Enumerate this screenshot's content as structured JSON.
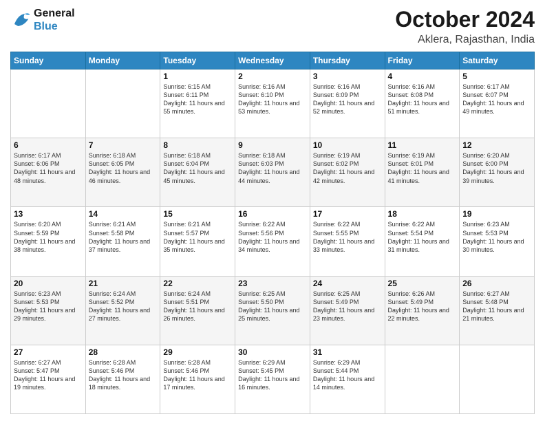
{
  "logo": {
    "line1": "General",
    "line2": "Blue"
  },
  "title": "October 2024",
  "subtitle": "Aklera, Rajasthan, India",
  "days_of_week": [
    "Sunday",
    "Monday",
    "Tuesday",
    "Wednesday",
    "Thursday",
    "Friday",
    "Saturday"
  ],
  "weeks": [
    [
      {
        "day": "",
        "sunrise": "",
        "sunset": "",
        "daylight": ""
      },
      {
        "day": "",
        "sunrise": "",
        "sunset": "",
        "daylight": ""
      },
      {
        "day": "1",
        "sunrise": "Sunrise: 6:15 AM",
        "sunset": "Sunset: 6:11 PM",
        "daylight": "Daylight: 11 hours and 55 minutes."
      },
      {
        "day": "2",
        "sunrise": "Sunrise: 6:16 AM",
        "sunset": "Sunset: 6:10 PM",
        "daylight": "Daylight: 11 hours and 53 minutes."
      },
      {
        "day": "3",
        "sunrise": "Sunrise: 6:16 AM",
        "sunset": "Sunset: 6:09 PM",
        "daylight": "Daylight: 11 hours and 52 minutes."
      },
      {
        "day": "4",
        "sunrise": "Sunrise: 6:16 AM",
        "sunset": "Sunset: 6:08 PM",
        "daylight": "Daylight: 11 hours and 51 minutes."
      },
      {
        "day": "5",
        "sunrise": "Sunrise: 6:17 AM",
        "sunset": "Sunset: 6:07 PM",
        "daylight": "Daylight: 11 hours and 49 minutes."
      }
    ],
    [
      {
        "day": "6",
        "sunrise": "Sunrise: 6:17 AM",
        "sunset": "Sunset: 6:06 PM",
        "daylight": "Daylight: 11 hours and 48 minutes."
      },
      {
        "day": "7",
        "sunrise": "Sunrise: 6:18 AM",
        "sunset": "Sunset: 6:05 PM",
        "daylight": "Daylight: 11 hours and 46 minutes."
      },
      {
        "day": "8",
        "sunrise": "Sunrise: 6:18 AM",
        "sunset": "Sunset: 6:04 PM",
        "daylight": "Daylight: 11 hours and 45 minutes."
      },
      {
        "day": "9",
        "sunrise": "Sunrise: 6:18 AM",
        "sunset": "Sunset: 6:03 PM",
        "daylight": "Daylight: 11 hours and 44 minutes."
      },
      {
        "day": "10",
        "sunrise": "Sunrise: 6:19 AM",
        "sunset": "Sunset: 6:02 PM",
        "daylight": "Daylight: 11 hours and 42 minutes."
      },
      {
        "day": "11",
        "sunrise": "Sunrise: 6:19 AM",
        "sunset": "Sunset: 6:01 PM",
        "daylight": "Daylight: 11 hours and 41 minutes."
      },
      {
        "day": "12",
        "sunrise": "Sunrise: 6:20 AM",
        "sunset": "Sunset: 6:00 PM",
        "daylight": "Daylight: 11 hours and 39 minutes."
      }
    ],
    [
      {
        "day": "13",
        "sunrise": "Sunrise: 6:20 AM",
        "sunset": "Sunset: 5:59 PM",
        "daylight": "Daylight: 11 hours and 38 minutes."
      },
      {
        "day": "14",
        "sunrise": "Sunrise: 6:21 AM",
        "sunset": "Sunset: 5:58 PM",
        "daylight": "Daylight: 11 hours and 37 minutes."
      },
      {
        "day": "15",
        "sunrise": "Sunrise: 6:21 AM",
        "sunset": "Sunset: 5:57 PM",
        "daylight": "Daylight: 11 hours and 35 minutes."
      },
      {
        "day": "16",
        "sunrise": "Sunrise: 6:22 AM",
        "sunset": "Sunset: 5:56 PM",
        "daylight": "Daylight: 11 hours and 34 minutes."
      },
      {
        "day": "17",
        "sunrise": "Sunrise: 6:22 AM",
        "sunset": "Sunset: 5:55 PM",
        "daylight": "Daylight: 11 hours and 33 minutes."
      },
      {
        "day": "18",
        "sunrise": "Sunrise: 6:22 AM",
        "sunset": "Sunset: 5:54 PM",
        "daylight": "Daylight: 11 hours and 31 minutes."
      },
      {
        "day": "19",
        "sunrise": "Sunrise: 6:23 AM",
        "sunset": "Sunset: 5:53 PM",
        "daylight": "Daylight: 11 hours and 30 minutes."
      }
    ],
    [
      {
        "day": "20",
        "sunrise": "Sunrise: 6:23 AM",
        "sunset": "Sunset: 5:53 PM",
        "daylight": "Daylight: 11 hours and 29 minutes."
      },
      {
        "day": "21",
        "sunrise": "Sunrise: 6:24 AM",
        "sunset": "Sunset: 5:52 PM",
        "daylight": "Daylight: 11 hours and 27 minutes."
      },
      {
        "day": "22",
        "sunrise": "Sunrise: 6:24 AM",
        "sunset": "Sunset: 5:51 PM",
        "daylight": "Daylight: 11 hours and 26 minutes."
      },
      {
        "day": "23",
        "sunrise": "Sunrise: 6:25 AM",
        "sunset": "Sunset: 5:50 PM",
        "daylight": "Daylight: 11 hours and 25 minutes."
      },
      {
        "day": "24",
        "sunrise": "Sunrise: 6:25 AM",
        "sunset": "Sunset: 5:49 PM",
        "daylight": "Daylight: 11 hours and 23 minutes."
      },
      {
        "day": "25",
        "sunrise": "Sunrise: 6:26 AM",
        "sunset": "Sunset: 5:49 PM",
        "daylight": "Daylight: 11 hours and 22 minutes."
      },
      {
        "day": "26",
        "sunrise": "Sunrise: 6:27 AM",
        "sunset": "Sunset: 5:48 PM",
        "daylight": "Daylight: 11 hours and 21 minutes."
      }
    ],
    [
      {
        "day": "27",
        "sunrise": "Sunrise: 6:27 AM",
        "sunset": "Sunset: 5:47 PM",
        "daylight": "Daylight: 11 hours and 19 minutes."
      },
      {
        "day": "28",
        "sunrise": "Sunrise: 6:28 AM",
        "sunset": "Sunset: 5:46 PM",
        "daylight": "Daylight: 11 hours and 18 minutes."
      },
      {
        "day": "29",
        "sunrise": "Sunrise: 6:28 AM",
        "sunset": "Sunset: 5:46 PM",
        "daylight": "Daylight: 11 hours and 17 minutes."
      },
      {
        "day": "30",
        "sunrise": "Sunrise: 6:29 AM",
        "sunset": "Sunset: 5:45 PM",
        "daylight": "Daylight: 11 hours and 16 minutes."
      },
      {
        "day": "31",
        "sunrise": "Sunrise: 6:29 AM",
        "sunset": "Sunset: 5:44 PM",
        "daylight": "Daylight: 11 hours and 14 minutes."
      },
      {
        "day": "",
        "sunrise": "",
        "sunset": "",
        "daylight": ""
      },
      {
        "day": "",
        "sunrise": "",
        "sunset": "",
        "daylight": ""
      }
    ]
  ]
}
